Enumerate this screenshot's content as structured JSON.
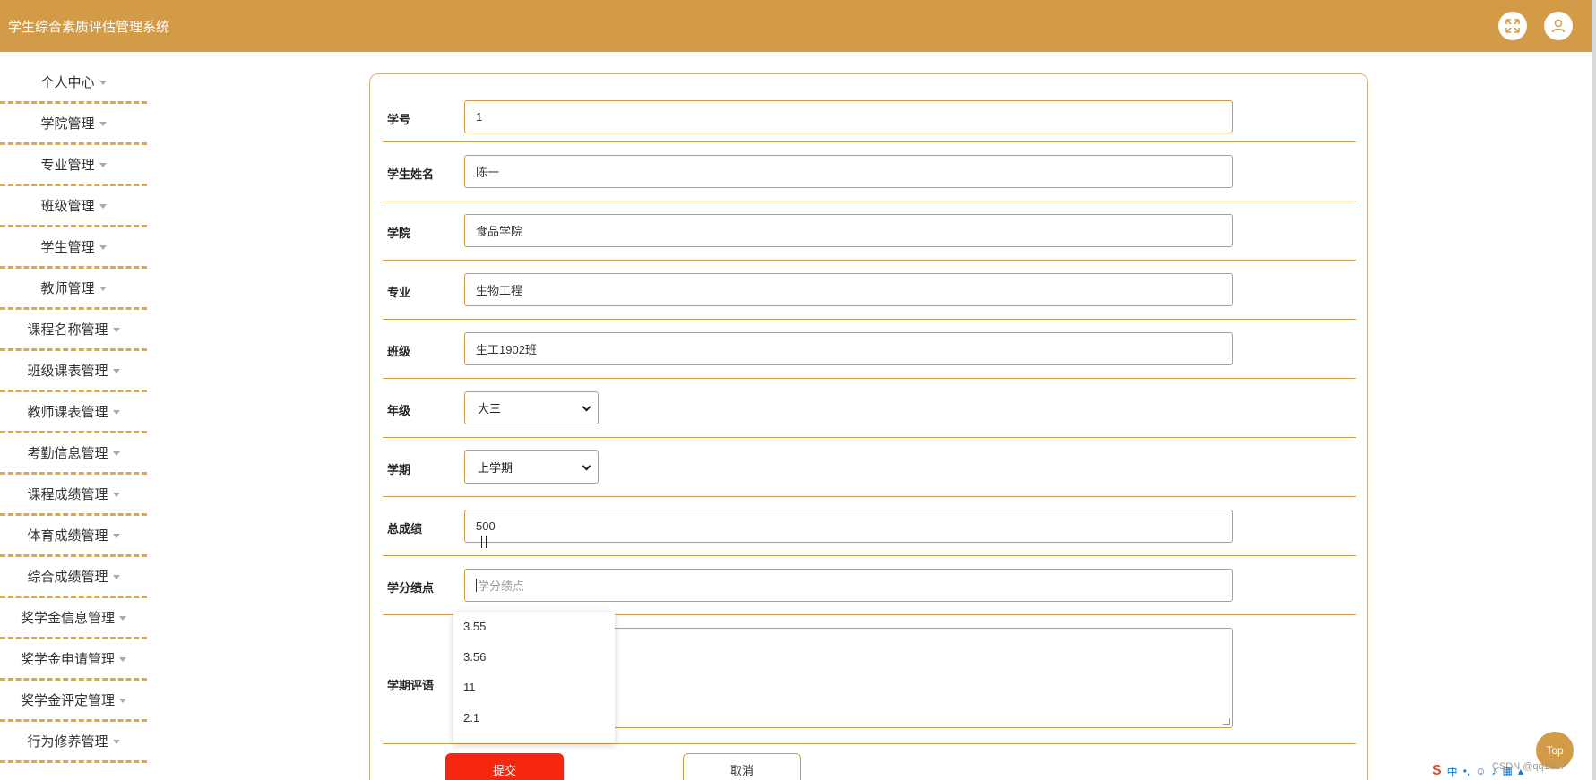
{
  "header": {
    "app_title": "学生综合素质评估管理系统",
    "fullscreen_icon": "fullscreen-icon",
    "user_icon": "user-icon",
    "color": "#d39b48"
  },
  "sidebar": {
    "items": [
      {
        "label": "个人中心"
      },
      {
        "label": "学院管理"
      },
      {
        "label": "专业管理"
      },
      {
        "label": "班级管理"
      },
      {
        "label": "学生管理"
      },
      {
        "label": "教师管理"
      },
      {
        "label": "课程名称管理"
      },
      {
        "label": "班级课表管理"
      },
      {
        "label": "教师课表管理"
      },
      {
        "label": "考勤信息管理"
      },
      {
        "label": "课程成绩管理"
      },
      {
        "label": "体育成绩管理"
      },
      {
        "label": "综合成绩管理"
      },
      {
        "label": "奖学金信息管理"
      },
      {
        "label": "奖学金申请管理"
      },
      {
        "label": "奖学金评定管理"
      },
      {
        "label": "行为修养管理"
      }
    ]
  },
  "form": {
    "student_id": {
      "label": "学号",
      "value": "1"
    },
    "student_name": {
      "label": "学生姓名",
      "value": "陈一"
    },
    "college": {
      "label": "学院",
      "value": "食品学院"
    },
    "major": {
      "label": "专业",
      "value": "生物工程"
    },
    "class": {
      "label": "班级",
      "value": "生工1902班"
    },
    "grade": {
      "label": "年级",
      "selected": "大三"
    },
    "semester": {
      "label": "学期",
      "selected": "上学期"
    },
    "total_score": {
      "label": "总成绩",
      "value": "500"
    },
    "gpa": {
      "label": "学分绩点",
      "placeholder": "学分绩点"
    },
    "comment": {
      "label": "学期评语",
      "value": ""
    },
    "gpa_suggestions": [
      "3.55",
      "3.56",
      "11",
      "2.1"
    ],
    "submit_label": "提交",
    "cancel_label": "取消"
  },
  "floating": {
    "top_label": "Top",
    "watermark": "CSDN @qq1017",
    "ime_text": "中"
  },
  "colors": {
    "accent": "#d39b48",
    "submit": "#f5280f",
    "menu_divider": "#e5a83e"
  }
}
